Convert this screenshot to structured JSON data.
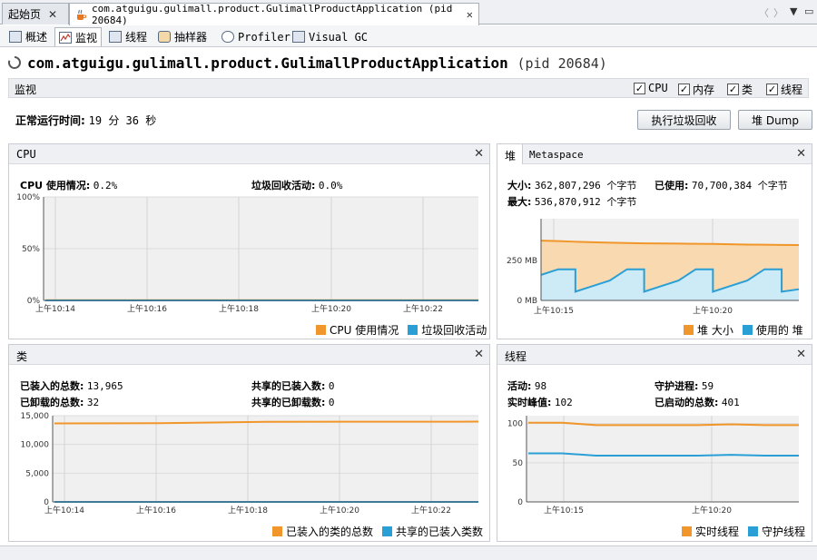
{
  "tabs": {
    "start_label": "起始页",
    "app_label": "com.atguigu.gulimall.product.GulimallProductApplication (pid 20684)"
  },
  "subtabs": [
    "概述",
    "监视",
    "线程",
    "抽样器",
    "Profiler",
    "Visual GC"
  ],
  "title": {
    "main": "com.atguigu.gulimall.product.GulimallProductApplication",
    "pid": "(pid 20684)"
  },
  "monitor": {
    "label": "监视",
    "checkboxes": [
      {
        "label": "CPU",
        "checked": true
      },
      {
        "label": "内存",
        "checked": true
      },
      {
        "label": "类",
        "checked": true
      },
      {
        "label": "线程",
        "checked": true
      }
    ],
    "uptime_label": "正常运行时间:",
    "uptime_value": "19 分 36 秒",
    "gc_button": "执行垃圾回收",
    "heapdump_button": "堆 Dump"
  },
  "colors": {
    "orange": "#f0962a",
    "blue": "#2a9fd6",
    "grid": "#d2d2d2"
  },
  "panels": {
    "cpu": {
      "title": "CPU",
      "usage_label": "CPU 使用情况:",
      "usage_value": "0.2%",
      "gc_label": "垃圾回收活动:",
      "gc_value": "0.0%",
      "legend": [
        "CPU 使用情况",
        "垃圾回收活动"
      ]
    },
    "heap": {
      "tab_heap": "堆",
      "tab_meta": "Metaspace",
      "size_label": "大小:",
      "size_value": "362,807,296 个字节",
      "used_label": "已使用:",
      "used_value": "70,700,384 个字节",
      "max_label": "最大:",
      "max_value": "536,870,912 个字节",
      "legend": [
        "堆 大小",
        "使用的 堆"
      ]
    },
    "classes": {
      "title": "类",
      "loaded_label": "已装入的总数:",
      "loaded_value": "13,965",
      "unloaded_label": "已卸载的总数:",
      "unloaded_value": "32",
      "shared_loaded_label": "共享的已装入数:",
      "shared_loaded_value": "0",
      "shared_unloaded_label": "共享的已卸载数:",
      "shared_unloaded_value": "0",
      "legend": [
        "已装入的类的总数",
        "共享的已装入类数"
      ]
    },
    "threads": {
      "title": "线程",
      "live_label": "活动:",
      "live_value": "98",
      "daemon_label": "守护进程:",
      "daemon_value": "59",
      "peak_label": "实时峰值:",
      "peak_value": "102",
      "started_label": "已启动的总数:",
      "started_value": "401",
      "legend": [
        "实时线程",
        "守护线程"
      ]
    }
  },
  "chart_data": [
    {
      "type": "line",
      "id": "cpu",
      "x": [
        "上午10:14",
        "上午10:16",
        "上午10:18",
        "上午10:20",
        "上午10:22"
      ],
      "yticks": [
        "100%",
        "50%",
        "0%"
      ],
      "ylim": [
        0,
        100
      ],
      "series": [
        {
          "name": "CPU 使用情况",
          "values": [
            0.2,
            0.2,
            0.2,
            0.2,
            0.2
          ]
        },
        {
          "name": "垃圾回收活动",
          "values": [
            0,
            0,
            0,
            0,
            0
          ]
        }
      ]
    },
    {
      "type": "area",
      "id": "heap",
      "x": [
        "上午10:15",
        "上午10:20"
      ],
      "yticks": [
        "250 MB",
        "0 MB"
      ],
      "ylim": [
        0,
        512
      ],
      "series": [
        {
          "name": "堆 大小",
          "values": [
            375,
            372,
            368,
            365,
            362,
            360,
            358,
            357,
            356,
            355,
            354,
            352,
            350,
            349,
            348,
            347
          ]
        },
        {
          "name": "使用的 堆",
          "values": [
            160,
            195,
            55,
            90,
            125,
            195,
            55,
            90,
            125,
            195,
            55,
            90,
            125,
            195,
            55,
            70
          ]
        }
      ]
    },
    {
      "type": "line",
      "id": "classes",
      "x": [
        "上午10:14",
        "上午10:16",
        "上午10:18",
        "上午10:20",
        "上午10:22"
      ],
      "yticks": [
        "15,000",
        "10,000",
        "5,000",
        "0"
      ],
      "ylim": [
        0,
        15000
      ],
      "series": [
        {
          "name": "已装入的类的总数",
          "values": [
            13650,
            13700,
            13940,
            13955,
            13965
          ]
        },
        {
          "name": "共享的已装入类数",
          "values": [
            0,
            0,
            0,
            0,
            0
          ]
        }
      ]
    },
    {
      "type": "line",
      "id": "threads",
      "x": [
        "上午10:15",
        "上午10:20"
      ],
      "yticks": [
        "100",
        "50",
        "0"
      ],
      "ylim": [
        0,
        110
      ],
      "series": [
        {
          "name": "实时线程",
          "values": [
            101,
            101,
            98,
            98,
            98,
            98,
            99,
            98,
            98
          ]
        },
        {
          "name": "守护线程",
          "values": [
            62,
            62,
            59,
            59,
            59,
            59,
            60,
            59,
            59
          ]
        }
      ]
    }
  ]
}
